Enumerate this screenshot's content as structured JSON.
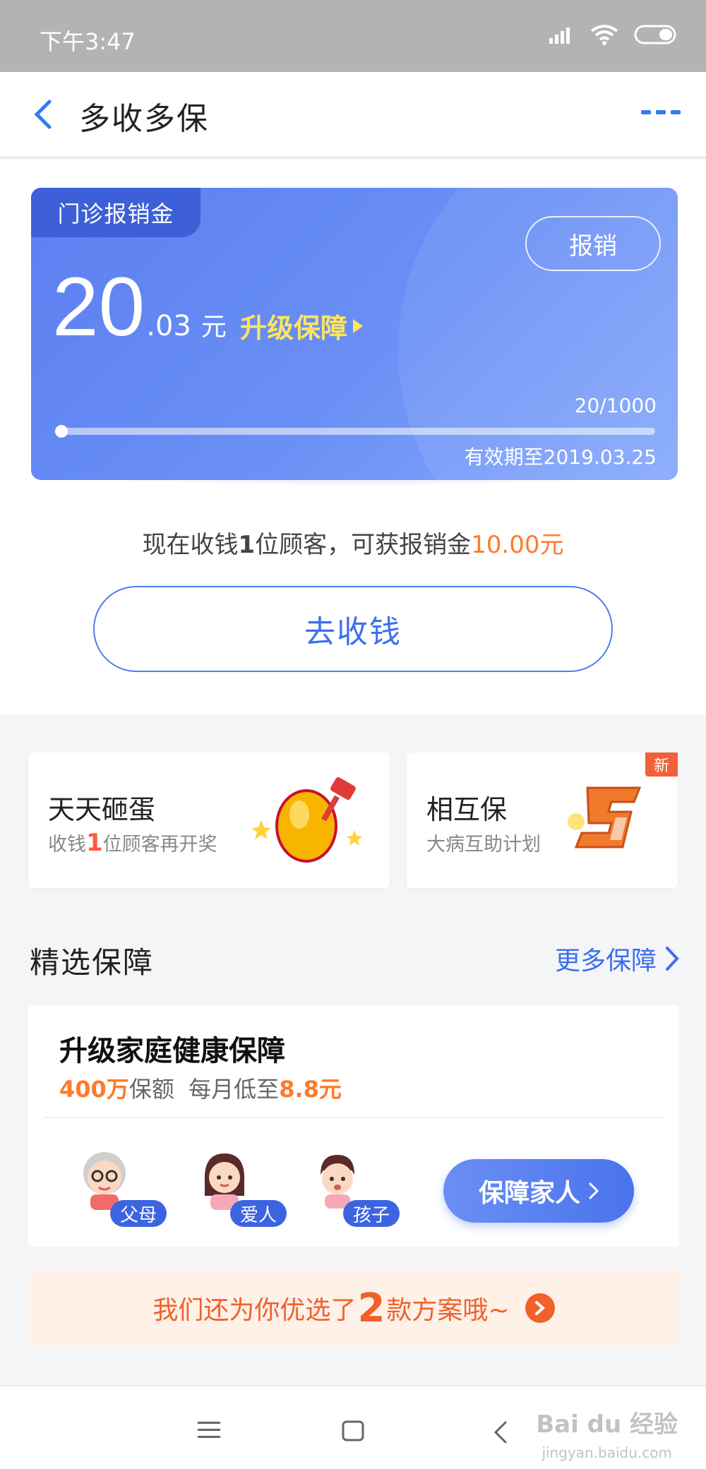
{
  "status_bar": {
    "time": "下午3:47"
  },
  "nav": {
    "title": "多收多保"
  },
  "reimburse_card": {
    "tag": "门诊报销金",
    "claim_label": "报销",
    "amount_int": "20",
    "amount_dec": ".03",
    "amount_unit": "元",
    "upgrade_label": "升级保障",
    "progress_text": "20/1000",
    "progress_fraction": 0.02,
    "expire_text": "有效期至2019.03.25"
  },
  "hint": {
    "prefix": "现在收钱",
    "count": "1",
    "middle": "位顾客，可获报销金",
    "amount": "10.00元"
  },
  "collect_button": "去收钱",
  "features": [
    {
      "title": "天天砸蛋",
      "sub_prefix": "收钱",
      "sub_number": "1",
      "sub_suffix": "位顾客再开奖",
      "icon": "golden-egg-hammer-icon"
    },
    {
      "title": "相互保",
      "sub": "大病互助计划",
      "badge": "新",
      "icon": "xianghubao-logo-icon"
    }
  ],
  "section": {
    "title": "精选保障",
    "more_label": "更多保障"
  },
  "insurance": {
    "title": "升级家庭健康保障",
    "coverage": "400万",
    "coverage_suffix": "保额",
    "monthly_prefix": "每月低至",
    "monthly_amount": "8.8元",
    "members": [
      {
        "label": "父母",
        "icon": "parent-avatar-icon"
      },
      {
        "label": "爱人",
        "icon": "spouse-avatar-icon"
      },
      {
        "label": "孩子",
        "icon": "child-avatar-icon"
      }
    ],
    "cta_label": "保障家人"
  },
  "plan_banner": {
    "prefix": "我们还为你优选了",
    "number": "2",
    "suffix": "款方案哦~"
  },
  "watermark": {
    "brand": "Bai du 经验",
    "url": "jingyan.baidu.com"
  },
  "colors": {
    "primary": "#3d6ef0",
    "card_gradient_start": "#5b7ff0",
    "accent_orange": "#ff7a2b",
    "upgrade_yellow": "#ffe45c"
  }
}
